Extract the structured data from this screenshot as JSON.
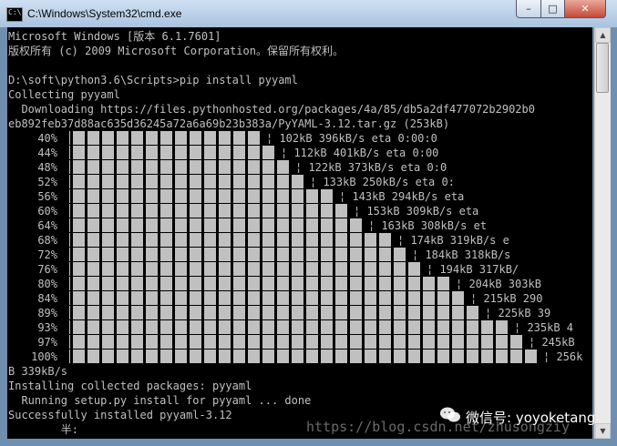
{
  "window": {
    "title": "C:\\Windows\\System32\\cmd.exe",
    "controls": {
      "minimize": "–",
      "maximize": "□",
      "close": "✕"
    }
  },
  "console": {
    "lines_top": [
      "Microsoft Windows [版本 6.1.7601]",
      "版权所有 (c) 2009 Microsoft Corporation。保留所有权利。",
      "",
      "D:\\soft\\python3.6\\Scripts>pip install pyyaml",
      "Collecting pyyaml",
      "  Downloading https://files.pythonhosted.org/packages/4a/85/db5a2df477072b2902b0",
      "eb892feb37d88ac635d36245a72a6a69b23b383a/PyYAML-3.12.tar.gz (253kB)"
    ],
    "progress_rows": [
      {
        "pct": "40%",
        "fill": 0.4,
        "tail": "¦ 102kB 396kB/s eta 0:00:0"
      },
      {
        "pct": "44%",
        "fill": 0.44,
        "tail": "¦ 112kB 401kB/s eta 0:00"
      },
      {
        "pct": "48%",
        "fill": 0.48,
        "tail": "¦ 122kB 373kB/s eta 0:0"
      },
      {
        "pct": "52%",
        "fill": 0.52,
        "tail": "¦ 133kB 250kB/s eta 0:"
      },
      {
        "pct": "56%",
        "fill": 0.56,
        "tail": "¦ 143kB 294kB/s eta"
      },
      {
        "pct": "60%",
        "fill": 0.6,
        "tail": "¦ 153kB 309kB/s eta"
      },
      {
        "pct": "64%",
        "fill": 0.64,
        "tail": "¦ 163kB 308kB/s et"
      },
      {
        "pct": "68%",
        "fill": 0.68,
        "tail": "¦ 174kB 319kB/s e"
      },
      {
        "pct": "72%",
        "fill": 0.72,
        "tail": "¦ 184kB 318kB/s"
      },
      {
        "pct": "76%",
        "fill": 0.76,
        "tail": "¦ 194kB 317kB/"
      },
      {
        "pct": "80%",
        "fill": 0.8,
        "tail": "¦ 204kB 303kB"
      },
      {
        "pct": "84%",
        "fill": 0.84,
        "tail": "¦ 215kB 290"
      },
      {
        "pct": "89%",
        "fill": 0.89,
        "tail": "¦ 225kB 39"
      },
      {
        "pct": "93%",
        "fill": 0.93,
        "tail": "¦ 235kB 4"
      },
      {
        "pct": "97%",
        "fill": 0.97,
        "tail": "¦ 245kB"
      },
      {
        "pct": "100%",
        "fill": 1.0,
        "tail": "¦ 256k"
      }
    ],
    "lines_bottom": [
      "B 339kB/s",
      "Installing collected packages: pyyaml",
      "  Running setup.py install for pyyaml ... done",
      "Successfully installed pyyaml-3.12",
      "        半:"
    ]
  },
  "watermark": {
    "account": "微信号: yoyoketang",
    "link": "https://blog.csdn.net/zhusongziy"
  },
  "colors": {
    "console_bg": "#000000",
    "console_fg": "#c0c0c0",
    "titlebar": "#b9cde4"
  }
}
